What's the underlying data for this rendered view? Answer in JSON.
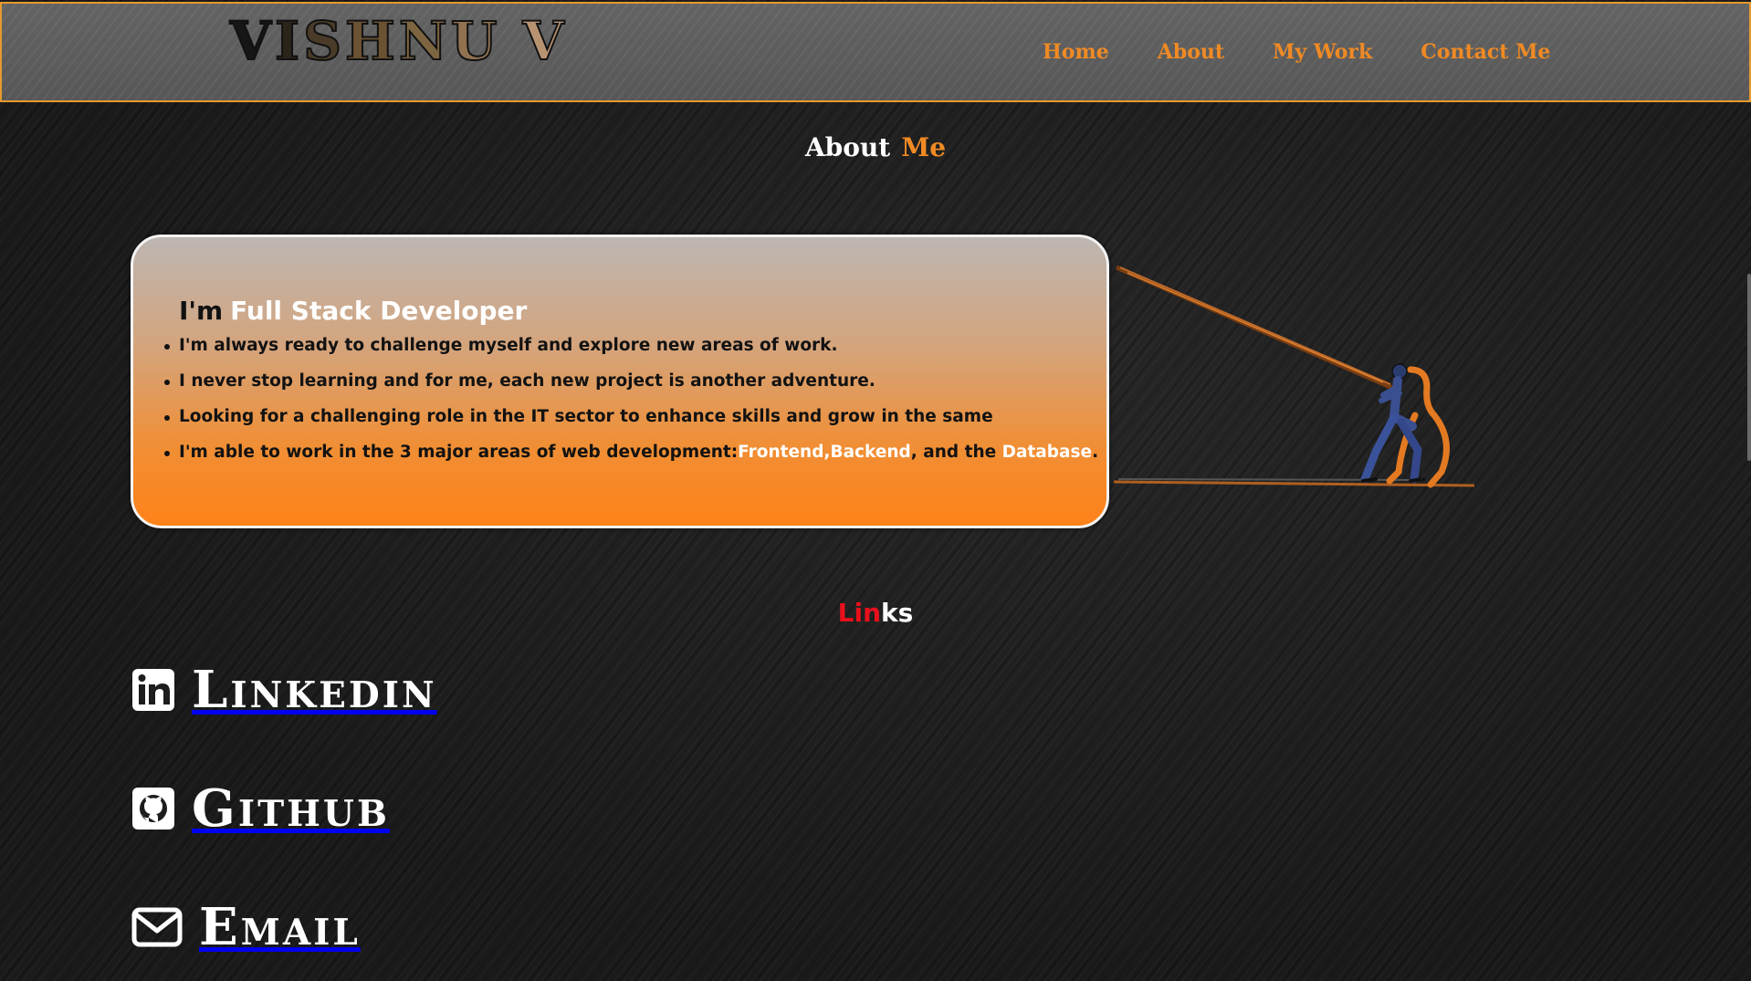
{
  "header": {
    "logo_letters": [
      "V",
      "I",
      "S",
      "H",
      "N",
      "U",
      " ",
      "V"
    ],
    "logo_colors": [
      "#161616",
      "#2b2419",
      "#4a3b28",
      "#6b5232",
      "#7d6541",
      "#917250",
      "#a07a55",
      "#b89372"
    ],
    "nav": [
      {
        "label": "Home"
      },
      {
        "label": "About"
      },
      {
        "label": "My Work"
      },
      {
        "label": "Contact Me"
      }
    ],
    "nav_color": "#f08a24",
    "border_color": "#e79a2c"
  },
  "about": {
    "title_part1": "About",
    "title_part2": "Me",
    "heading_prefix": "I'm",
    "heading_role": "Full Stack Developer",
    "bullets": [
      {
        "text": "I'm always ready to challenge myself and explore new areas of work."
      },
      {
        "text": "I never stop learning and for me, each new project is another adventure."
      },
      {
        "text": "Looking for a challenging role in the IT sector to enhance skills and grow in the same"
      },
      {
        "parts": [
          "I'm able to work in the 3 major areas of web development:",
          "Frontend,",
          "Backend",
          ", and the ",
          "Database",
          "."
        ]
      }
    ]
  },
  "links": {
    "title_red": "Lin",
    "title_white": "ks",
    "items": [
      {
        "label": "Linkedin",
        "icon": "linkedin-icon"
      },
      {
        "label": "Github",
        "icon": "github-icon"
      },
      {
        "label": "Email",
        "icon": "envelope-icon"
      }
    ]
  },
  "colors": {
    "accent_orange": "#f08a24",
    "links_red": "#e8101b",
    "background": "#1d1d1d"
  }
}
